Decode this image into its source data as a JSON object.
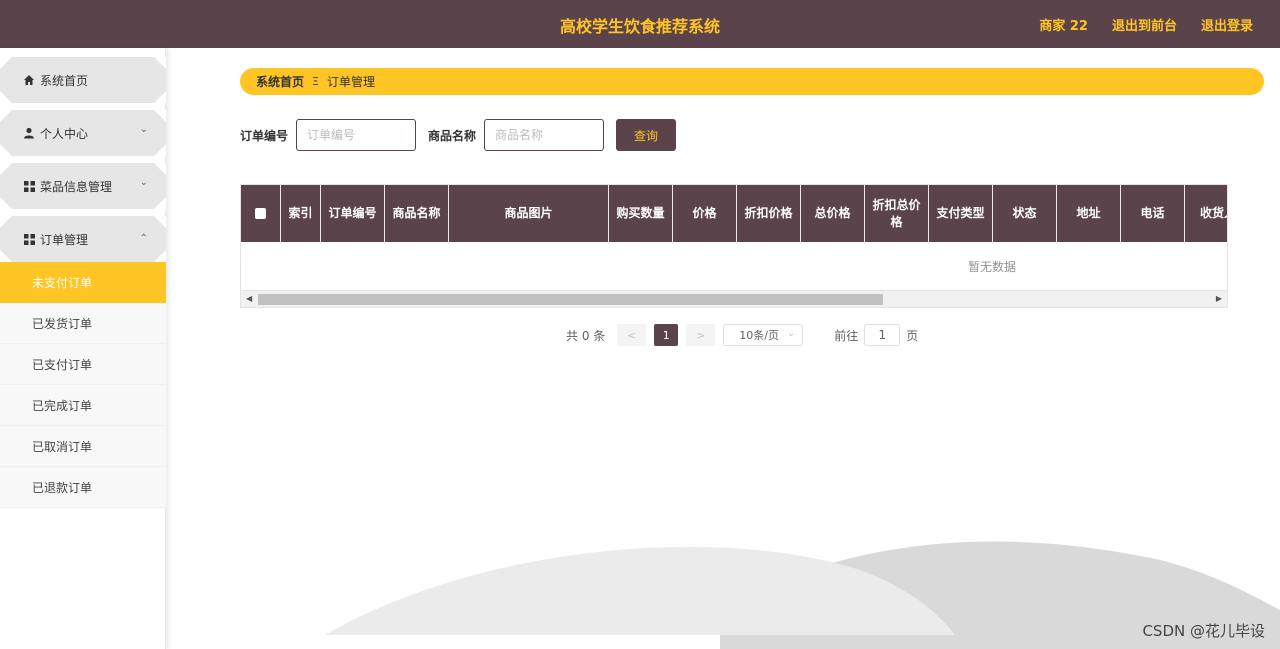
{
  "header": {
    "title": "高校学生饮食推荐系统",
    "user": "商家 22",
    "back_to_front": "退出到前台",
    "logout": "退出登录",
    "colors": {
      "bar": "#5b434b",
      "accent": "#ffc524"
    }
  },
  "sidebar": {
    "items": [
      {
        "label": "系统首页",
        "icon": "home-icon"
      },
      {
        "label": "个人中心",
        "icon": "user-icon"
      },
      {
        "label": "菜品信息管理",
        "icon": "grid-icon"
      },
      {
        "label": "订单管理",
        "icon": "grid-icon"
      }
    ],
    "submenu": [
      {
        "label": "未支付订单",
        "active": true
      },
      {
        "label": "已发货订单"
      },
      {
        "label": "已支付订单"
      },
      {
        "label": "已完成订单"
      },
      {
        "label": "已取消订单"
      },
      {
        "label": "已退款订单"
      }
    ]
  },
  "breadcrumb": {
    "home": "系统首页",
    "separator": "Ξ",
    "current": "订单管理"
  },
  "search": {
    "order_no_label": "订单编号",
    "order_no_placeholder": "订单编号",
    "product_name_label": "商品名称",
    "product_name_placeholder": "商品名称",
    "query_button": "查询"
  },
  "table": {
    "columns": [
      "索引",
      "订单编号",
      "商品名称",
      "商品图片",
      "购买数量",
      "价格",
      "折扣价格",
      "总价格",
      "折扣总价格",
      "支付类型",
      "状态",
      "地址",
      "电话",
      "收货人"
    ],
    "empty_text": "暂无数据"
  },
  "pagination": {
    "total": "共 0 条",
    "prev": "<",
    "current_page": "1",
    "next": ">",
    "page_size": "10条/页",
    "goto_label": "前往",
    "goto_value": "1",
    "page_unit": "页"
  },
  "watermark": "CSDN @花儿毕设"
}
